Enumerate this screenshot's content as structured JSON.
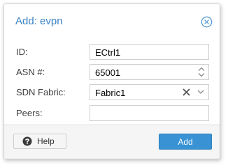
{
  "dialog": {
    "title": "Add: evpn",
    "close_icon": "close-circle-icon"
  },
  "form": {
    "id": {
      "label": "ID:",
      "value": "ECtrl1"
    },
    "asn": {
      "label": "ASN #:",
      "value": "65001"
    },
    "fabric": {
      "label": "SDN Fabric:",
      "value": "Fabric1"
    },
    "peers": {
      "label": "Peers:",
      "value": ""
    }
  },
  "footer": {
    "help_label": "Help",
    "add_label": "Add"
  },
  "colors": {
    "accent": "#3892d4",
    "title": "#3a82c4",
    "footer_bg": "#f5f5f5"
  }
}
